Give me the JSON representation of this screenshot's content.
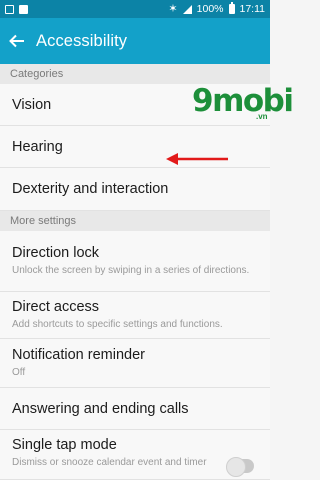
{
  "status_bar": {
    "battery": "100%",
    "time": "17:11",
    "icons": [
      "notification-icon",
      "screenshot-icon",
      "wifi-icon",
      "star-icon",
      "signal-icon",
      "battery-icon"
    ]
  },
  "app_bar": {
    "title": "Accessibility",
    "back_icon": "back-arrow-icon"
  },
  "sections": {
    "categories": "Categories",
    "more_settings": "More settings"
  },
  "categories": [
    {
      "label": "Vision"
    },
    {
      "label": "Hearing"
    },
    {
      "label": "Dexterity and interaction"
    }
  ],
  "more_settings": [
    {
      "label": "Direction lock",
      "sub": "Unlock the screen by swiping in a series of directions."
    },
    {
      "label": "Direct access",
      "sub": "Add shortcuts to specific settings and functions."
    },
    {
      "label": "Notification reminder",
      "sub": "Off"
    },
    {
      "label": "Answering and ending calls"
    },
    {
      "label": "Single tap mode",
      "sub": "Dismiss or snooze calendar event and timer"
    }
  ],
  "watermark": {
    "brand": "9mobi",
    "domain": ".vn"
  },
  "colors": {
    "status_bar": "#0c83a6",
    "app_bar": "#13a1c9",
    "annotation_arrow": "#e21a1a"
  }
}
